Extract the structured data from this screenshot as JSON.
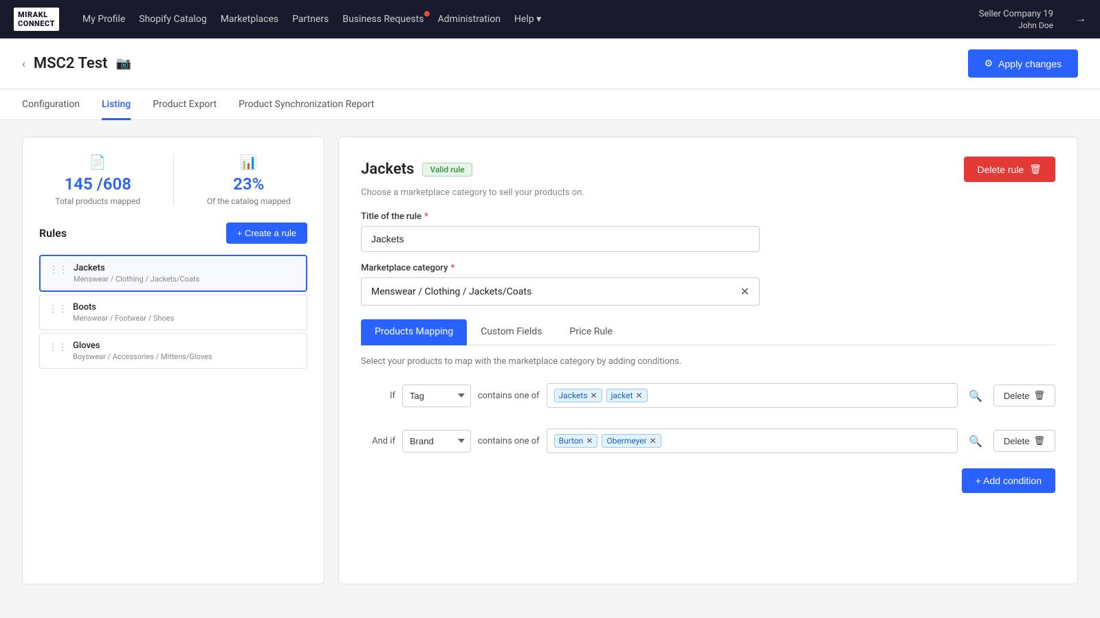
{
  "topnav": {
    "logo_line1": "MIRAKL",
    "logo_line2": "CONNECT",
    "links": [
      {
        "label": "My Profile",
        "id": "my-profile"
      },
      {
        "label": "Shopify Catalog",
        "id": "shopify-catalog"
      },
      {
        "label": "Marketplaces",
        "id": "marketplaces"
      },
      {
        "label": "Partners",
        "id": "partners"
      },
      {
        "label": "Business Requests",
        "id": "business-requests",
        "has_dot": true
      },
      {
        "label": "Administration",
        "id": "administration"
      },
      {
        "label": "Help ▾",
        "id": "help"
      }
    ],
    "user": {
      "company": "Seller Company 19",
      "name": "John Doe"
    }
  },
  "page": {
    "back_label": "‹",
    "title": "MSC2 Test",
    "apply_changes_label": "Apply changes",
    "gear_icon": "⚙"
  },
  "tabs": [
    {
      "label": "Configuration",
      "id": "configuration"
    },
    {
      "label": "Listing",
      "id": "listing",
      "active": true
    },
    {
      "label": "Product Export",
      "id": "product-export"
    },
    {
      "label": "Product Synchronization Report",
      "id": "product-sync-report"
    }
  ],
  "left_panel": {
    "stats": [
      {
        "number": "145 /608",
        "label": "Total products mapped",
        "icon": "📄"
      },
      {
        "number": "23%",
        "label": "Of the catalog mapped",
        "icon": "📊"
      }
    ],
    "rules_title": "Rules",
    "create_rule_label": "+ Create a rule",
    "rules": [
      {
        "name": "Jackets",
        "path": "Menswear / Clothing / Jackets/Coats",
        "active": true
      },
      {
        "name": "Boots",
        "path": "Menswear / Footwear / Shoes",
        "active": false
      },
      {
        "name": "Gloves",
        "path": "Boyswear / Accessories / Mittens/Gloves",
        "active": false
      }
    ]
  },
  "right_panel": {
    "rule_title": "Jackets",
    "valid_badge": "Valid rule",
    "delete_rule_label": "Delete rule",
    "trash_icon": "🗑",
    "subtitle": "Choose a marketplace category to sell your products on.",
    "title_of_rule_label": "Title of the rule",
    "title_of_rule_value": "Jackets",
    "marketplace_category_label": "Marketplace category",
    "marketplace_category_value": "Menswear / Clothing / Jackets/Coats",
    "sub_tabs": [
      {
        "label": "Products Mapping",
        "id": "products-mapping",
        "active": true
      },
      {
        "label": "Custom Fields",
        "id": "custom-fields"
      },
      {
        "label": "Price Rule",
        "id": "price-rule"
      }
    ],
    "mapping_subtitle": "Select your products to map with the marketplace category by adding conditions.",
    "conditions": [
      {
        "prefix": "If",
        "field": "Tag",
        "operator": "contains one of",
        "tags": [
          {
            "label": "Jackets"
          },
          {
            "label": "jacket"
          }
        ]
      },
      {
        "prefix": "And if",
        "field": "Brand",
        "operator": "contains one of",
        "tags": [
          {
            "label": "Burton"
          },
          {
            "label": "Obermeyer"
          }
        ]
      }
    ],
    "add_condition_label": "+ Add condition",
    "delete_label": "Delete"
  }
}
